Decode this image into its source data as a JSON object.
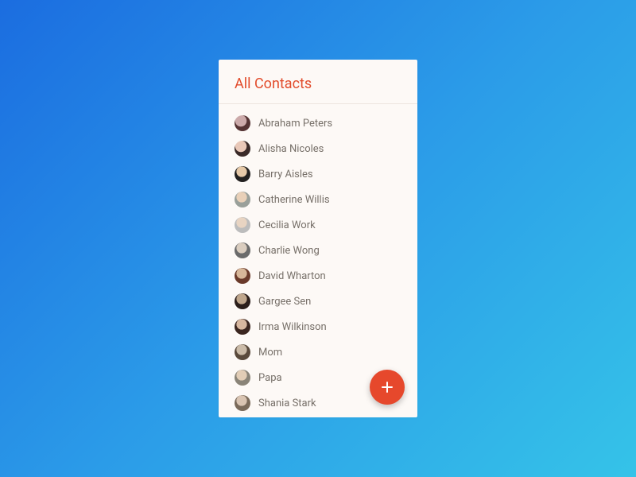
{
  "header": {
    "title": "All Contacts"
  },
  "contacts": [
    {
      "name": "Abraham Peters"
    },
    {
      "name": "Alisha Nicoles"
    },
    {
      "name": "Barry Aisles"
    },
    {
      "name": "Catherine Willis"
    },
    {
      "name": "Cecilia Work"
    },
    {
      "name": "Charlie Wong"
    },
    {
      "name": "David Wharton"
    },
    {
      "name": "Gargee Sen"
    },
    {
      "name": "Irma Wilkinson"
    },
    {
      "name": "Mom"
    },
    {
      "name": "Papa"
    },
    {
      "name": "Shania Stark"
    }
  ],
  "fab": {
    "icon": "plus-icon"
  },
  "colors": {
    "accent": "#e24b2b",
    "fab": "#e6482c",
    "card_bg": "#fdf9f6"
  }
}
